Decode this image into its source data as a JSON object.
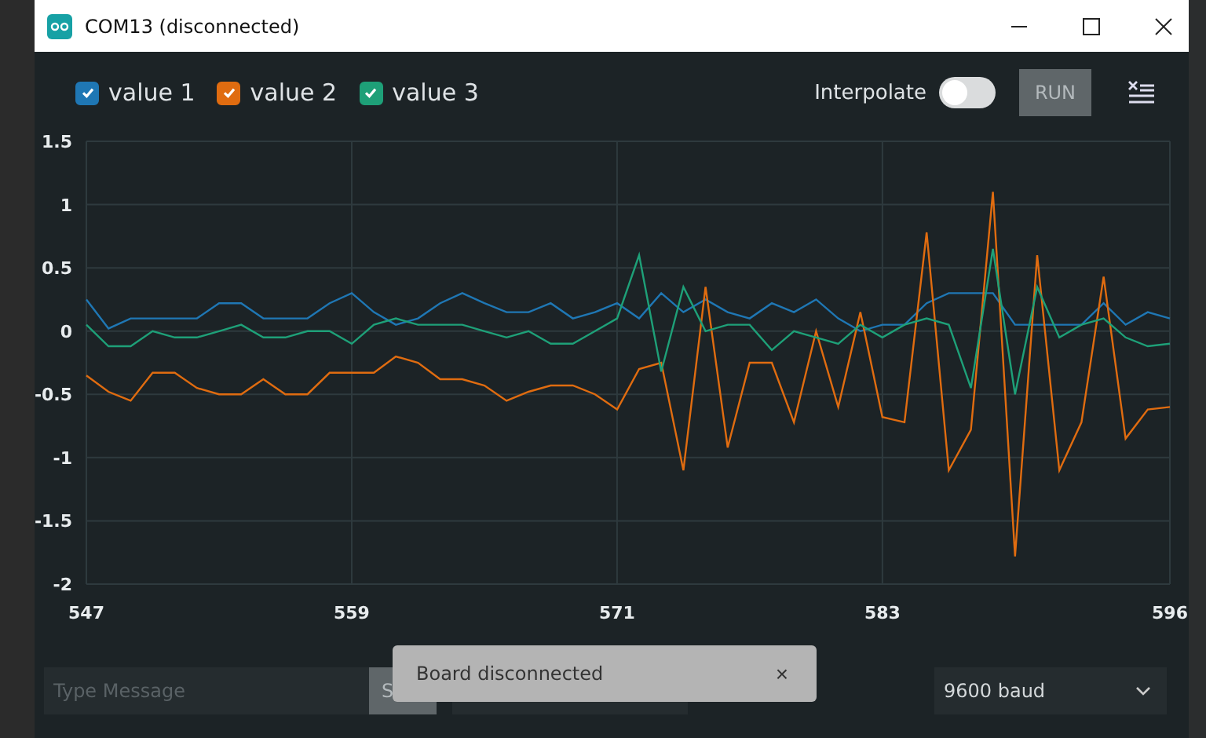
{
  "window": {
    "title": "COM13 (disconnected)"
  },
  "legend": [
    {
      "checked": true
    },
    {
      "checked": true
    },
    {
      "checked": true
    }
  ],
  "toolbar": {
    "interpolate": {
      "label": "Interpolate",
      "on": false
    },
    "run_button": {
      "label": "RUN",
      "disabled": true
    }
  },
  "chart_data": {
    "type": "line",
    "grid": true,
    "x": [
      547,
      548,
      549,
      550,
      551,
      552,
      553,
      554,
      555,
      556,
      557,
      558,
      559,
      560,
      561,
      562,
      563,
      564,
      565,
      566,
      567,
      568,
      569,
      570,
      571,
      572,
      573,
      574,
      575,
      576,
      577,
      578,
      579,
      580,
      581,
      582,
      583,
      584,
      585,
      586,
      587,
      588,
      589,
      590,
      591,
      592,
      593,
      594,
      595,
      596
    ],
    "xlim": [
      547,
      596
    ],
    "ylim": [
      -2,
      1.5
    ],
    "xticks": [
      547,
      559,
      571,
      583,
      596
    ],
    "yticks": [
      -2,
      -1.5,
      -1,
      -0.5,
      0,
      0.5,
      1,
      1.5
    ],
    "series": [
      {
        "name": "value 1",
        "color": "#1f77b4",
        "values": [
          0.25,
          0.02,
          0.1,
          0.1,
          0.1,
          0.1,
          0.22,
          0.22,
          0.1,
          0.1,
          0.1,
          0.22,
          0.3,
          0.15,
          0.05,
          0.1,
          0.22,
          0.3,
          0.22,
          0.15,
          0.15,
          0.22,
          0.1,
          0.15,
          0.22,
          0.1,
          0.3,
          0.15,
          0.25,
          0.15,
          0.1,
          0.22,
          0.15,
          0.25,
          0.1,
          0.0,
          0.05,
          0.05,
          0.22,
          0.3,
          0.3,
          0.3,
          0.05,
          0.05,
          0.05,
          0.05,
          0.22,
          0.05,
          0.15,
          0.1
        ]
      },
      {
        "name": "value 2",
        "color": "#e06c10",
        "values": [
          -0.35,
          -0.48,
          -0.55,
          -0.33,
          -0.33,
          -0.45,
          -0.5,
          -0.5,
          -0.38,
          -0.5,
          -0.5,
          -0.33,
          -0.33,
          -0.33,
          -0.2,
          -0.25,
          -0.38,
          -0.38,
          -0.43,
          -0.55,
          -0.48,
          -0.43,
          -0.43,
          -0.5,
          -0.62,
          -0.3,
          -0.25,
          -1.1,
          0.35,
          -0.92,
          -0.25,
          -0.25,
          -0.72,
          0.0,
          -0.6,
          0.15,
          -0.68,
          -0.72,
          0.78,
          -1.1,
          -0.78,
          1.1,
          -1.78,
          0.6,
          -1.1,
          -0.72,
          0.43,
          -0.85,
          -0.62,
          -0.6
        ]
      },
      {
        "name": "value 3",
        "color": "#1ea078",
        "values": [
          0.05,
          -0.12,
          -0.12,
          0.0,
          -0.05,
          -0.05,
          0.0,
          0.05,
          -0.05,
          -0.05,
          0.0,
          0.0,
          -0.1,
          0.05,
          0.1,
          0.05,
          0.05,
          0.05,
          0.0,
          -0.05,
          0.0,
          -0.1,
          -0.1,
          0.0,
          0.1,
          0.6,
          -0.32,
          0.35,
          0.0,
          0.05,
          0.05,
          -0.15,
          0.0,
          -0.05,
          -0.1,
          0.05,
          -0.05,
          0.05,
          0.1,
          0.05,
          -0.45,
          0.65,
          -0.5,
          0.35,
          -0.05,
          0.05,
          0.1,
          -0.05,
          -0.12,
          -0.1
        ]
      }
    ]
  },
  "message_field": {
    "placeholder": "Type Message"
  },
  "send_button": {
    "label": "S"
  },
  "baud_select": {
    "value": "9600 baud"
  },
  "toast": {
    "text": "Board disconnected",
    "close": "×"
  }
}
